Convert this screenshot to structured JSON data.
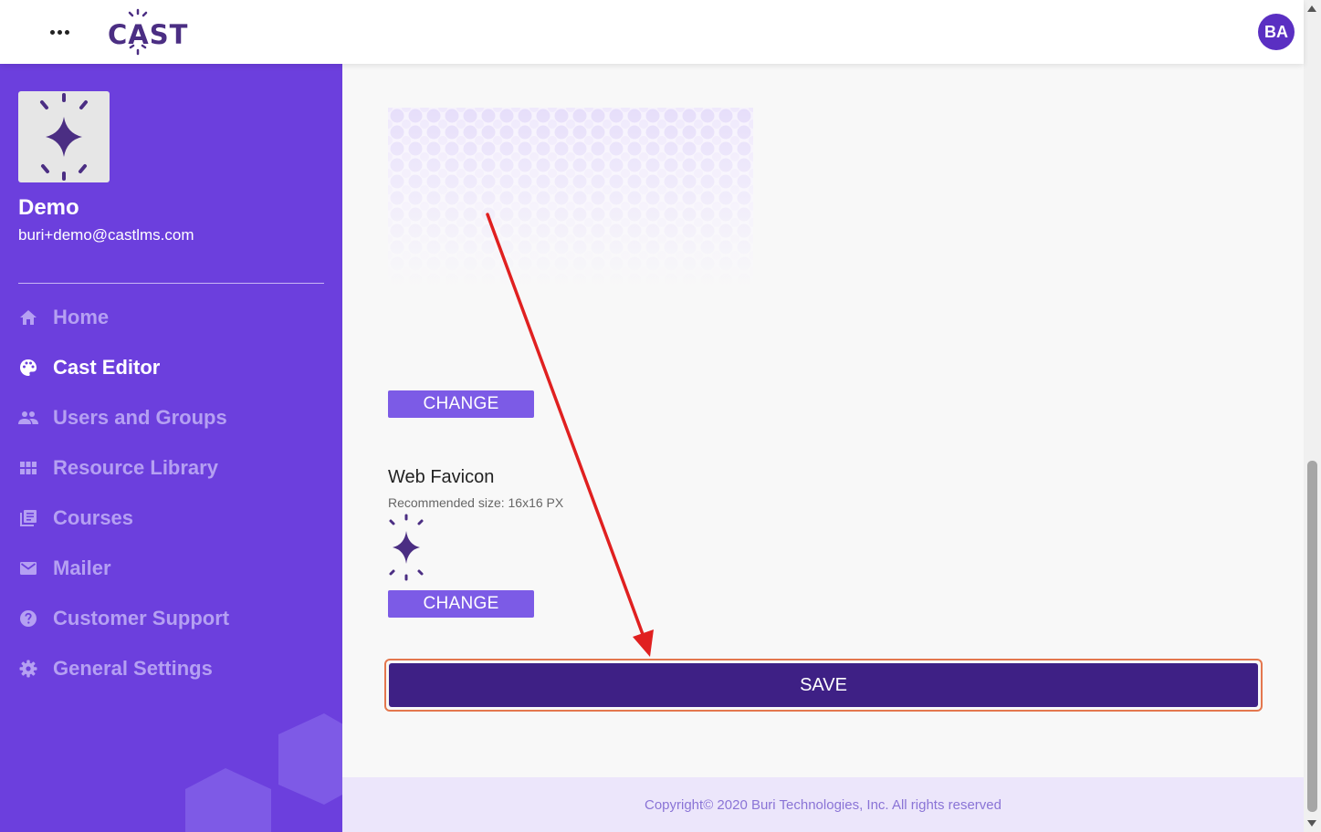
{
  "header": {
    "logo_text": "CAST",
    "avatar_initials": "BA"
  },
  "sidebar": {
    "org_name": "Demo",
    "org_email": "buri+demo@castlms.com",
    "items": [
      {
        "label": "Home",
        "icon": "home-icon",
        "active": false
      },
      {
        "label": "Cast Editor",
        "icon": "palette-icon",
        "active": true
      },
      {
        "label": "Users and Groups",
        "icon": "people-icon",
        "active": false
      },
      {
        "label": "Resource Library",
        "icon": "grid-icon",
        "active": false
      },
      {
        "label": "Courses",
        "icon": "library-books-icon",
        "active": false
      },
      {
        "label": "Mailer",
        "icon": "mail-icon",
        "active": false
      },
      {
        "label": "Customer Support",
        "icon": "help-circle-icon",
        "active": false
      },
      {
        "label": "General Settings",
        "icon": "gear-icon",
        "active": false
      }
    ]
  },
  "main": {
    "change_label_1": "CHANGE",
    "favicon_title": "Web Favicon",
    "favicon_subtitle": "Recommended size: 16x16 PX",
    "change_label_2": "CHANGE",
    "save_label": "SAVE"
  },
  "footer": {
    "copyright": "Copyright© 2020 Buri Technologies, Inc. All rights reserved"
  },
  "colors": {
    "brand": "#4b2e83",
    "sidebar_bg": "#6c3fdd",
    "button": "#7c5be6",
    "save_button": "#3e2085",
    "highlight": "#e4774e",
    "annotation_arrow": "#e02020"
  }
}
